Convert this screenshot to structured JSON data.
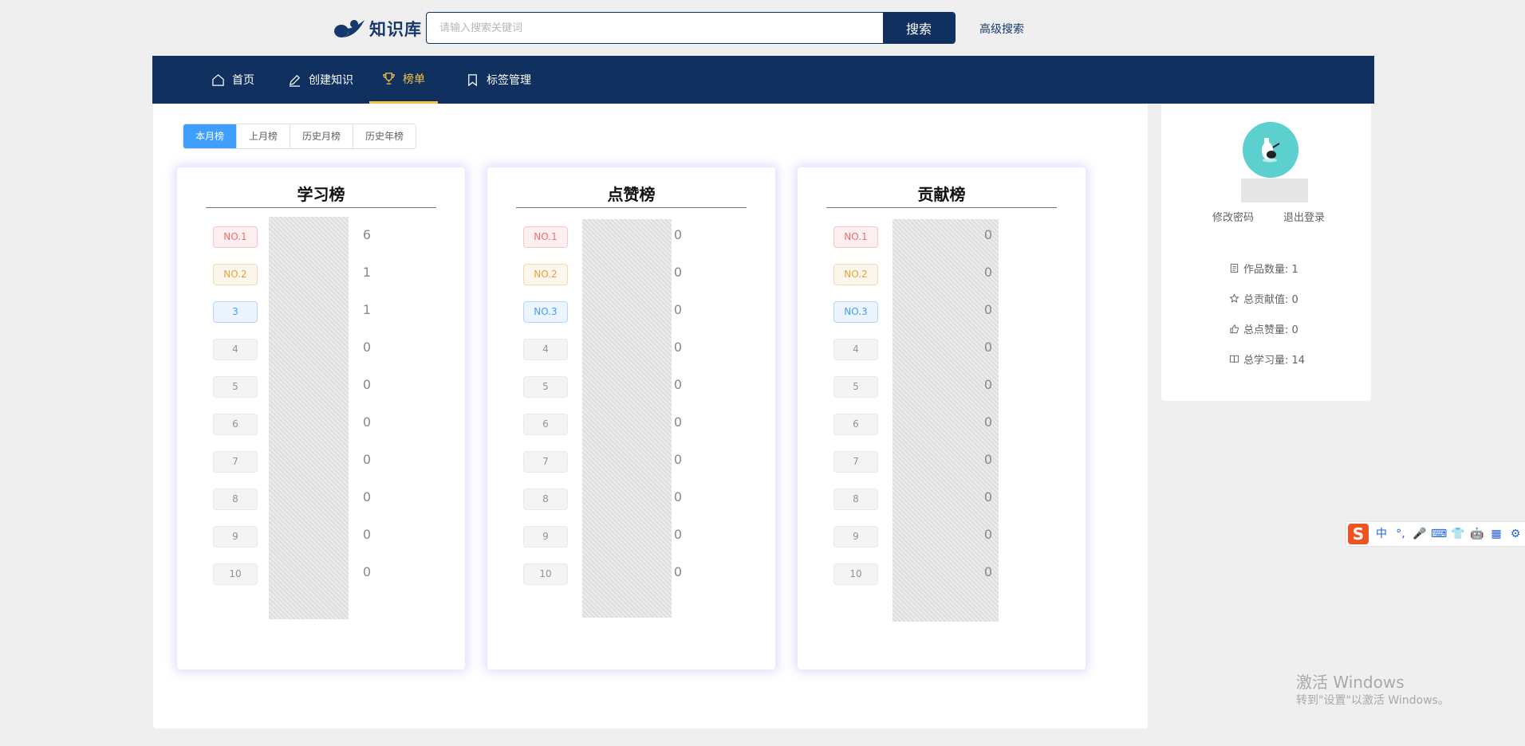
{
  "header": {
    "logo_text": "知识库",
    "search_placeholder": "请输入搜索关键词",
    "search_button": "搜索",
    "advanced_search": "高级搜索"
  },
  "nav": [
    {
      "label": "首页",
      "icon": "home-icon",
      "active": false
    },
    {
      "label": "创建知识",
      "icon": "edit-icon",
      "active": false
    },
    {
      "label": "榜单",
      "icon": "trophy-icon",
      "active": true
    },
    {
      "label": "标签管理",
      "icon": "bookmark-icon",
      "active": false
    }
  ],
  "tabs": [
    {
      "label": "本月榜",
      "active": true
    },
    {
      "label": "上月榜",
      "active": false
    },
    {
      "label": "历史月榜",
      "active": false
    },
    {
      "label": "历史年榜",
      "active": false
    }
  ],
  "leaderboards": [
    {
      "title": "学习榜",
      "ranks": [
        "NO.1",
        "NO.2",
        "3",
        "4",
        "5",
        "6",
        "7",
        "8",
        "9",
        "10"
      ],
      "scores": [
        "6",
        "1",
        "1",
        "0",
        "0",
        "0",
        "0",
        "0",
        "0",
        "0"
      ]
    },
    {
      "title": "点赞榜",
      "ranks": [
        "NO.1",
        "NO.2",
        "NO.3",
        "4",
        "5",
        "6",
        "7",
        "8",
        "9",
        "10"
      ],
      "scores": [
        "0",
        "0",
        "0",
        "0",
        "0",
        "0",
        "0",
        "0",
        "0",
        "0"
      ]
    },
    {
      "title": "贡献榜",
      "ranks": [
        "NO.1",
        "NO.2",
        "NO.3",
        "4",
        "5",
        "6",
        "7",
        "8",
        "9",
        "10"
      ],
      "scores": [
        "0",
        "0",
        "0",
        "0",
        "0",
        "0",
        "0",
        "0",
        "0",
        "0"
      ]
    }
  ],
  "profile": {
    "change_password": "修改密码",
    "logout": "退出登录",
    "stats": [
      {
        "icon": "document-icon",
        "text": "作品数量: 1"
      },
      {
        "icon": "star-icon",
        "text": "总贡献值: 0"
      },
      {
        "icon": "thumbs-up-icon",
        "text": "总点赞量: 0"
      },
      {
        "icon": "book-icon",
        "text": "总学习量: 14"
      }
    ]
  },
  "ime": {
    "logo": "S",
    "items": [
      "中",
      "°,",
      "🎤",
      "⌨",
      "👕",
      "🤖",
      "▦",
      "⚙"
    ]
  },
  "watermark": {
    "line1": "激活 Windows",
    "line2": "转到\"设置\"以激活 Windows。"
  },
  "colors": {
    "navy": "#10305f",
    "accent_yellow": "#f5c242",
    "tab_active": "#409eff",
    "avatar_bg": "#5cd0cf"
  }
}
